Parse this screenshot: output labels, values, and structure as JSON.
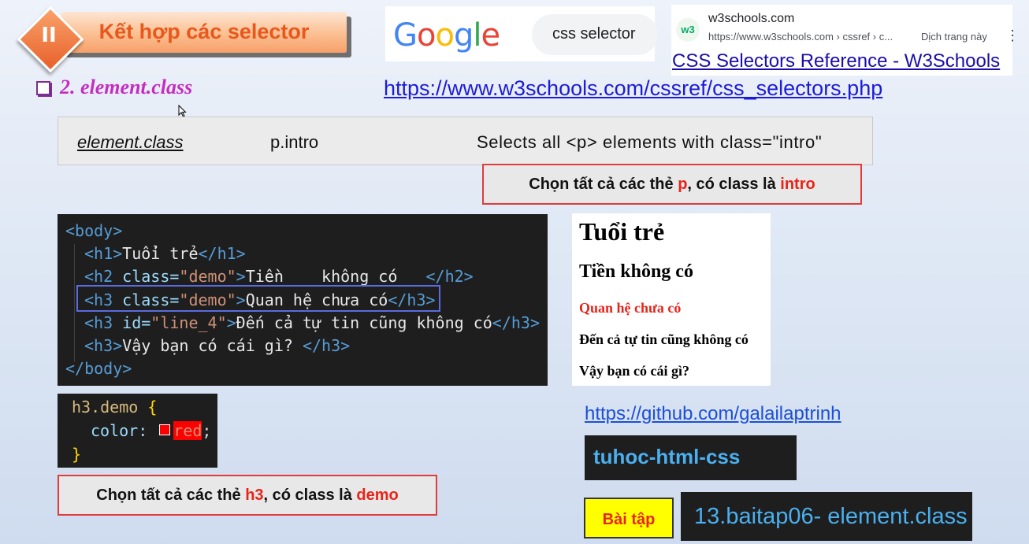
{
  "banner": {
    "number": "II",
    "title": "Kết hợp các selector"
  },
  "google": {
    "logo": "Google",
    "query": "css selector"
  },
  "w3_result": {
    "icon": "w3",
    "site": "w3schools.com",
    "url": "https://www.w3schools.com › cssref › c...",
    "translate": "Dịch trang này",
    "menu_icon": "⋮",
    "title": "CSS Selectors Reference - W3Schools"
  },
  "section": {
    "title": "2.  element.class",
    "reference_url": "https://www.w3schools.com/cssref/css_selectors.php"
  },
  "reference_row": {
    "selector": "element.class",
    "example": "p.intro",
    "description": "Selects all <p> elements with class=\"intro\""
  },
  "note_top": {
    "prefix": "Chọn tất cả các thẻ ",
    "tag": "p",
    "middle": ", có class là ",
    "cls": "intro"
  },
  "note_bottom": {
    "prefix": "Chọn tất cả các thẻ ",
    "tag": "h3",
    "middle": ", có class là ",
    "cls": "demo"
  },
  "html_code": [
    {
      "open": "<body>"
    },
    {
      "open": "<h1>",
      "text": "Tuổi trẻ",
      "close": "</h1>"
    },
    {
      "open": "<h2 ",
      "attr": "class=",
      "val": "\"demo\"",
      "gt": ">",
      "text": "Tiền    không có   ",
      "close": "</h2>"
    },
    {
      "open": "<h3 ",
      "attr": "class=",
      "val": "\"demo\"",
      "gt": ">",
      "text": "Quan hệ chưa có",
      "close": "</h3>"
    },
    {
      "open": "<h3 ",
      "attr": "id=",
      "val": "\"line_4\"",
      "gt": ">",
      "text": "Đến cả tự tin cũng không có",
      "close": "</h3>"
    },
    {
      "open": "<h3>",
      "text": "Vậy bạn có cái gì? ",
      "close": "</h3>"
    },
    {
      "open": "</body>"
    }
  ],
  "css_code": {
    "selector": "h3.demo",
    "open_brace": "{",
    "property": "color:",
    "value": "red",
    "semicolon": ";",
    "close_brace": "}",
    "swatch_color": "#ff0000"
  },
  "preview": {
    "h1": "Tuổi trẻ",
    "h2": "Tiền không có",
    "h3_demo": "Quan hệ chưa có",
    "h3_line4": "Đến cả tự tin cũng không có",
    "h3_last": "Vậy bạn có cái gì?"
  },
  "github_url": "https://github.com/galailaptrinh",
  "repo_name": "tuhoc-html-css",
  "exercise_button": "Bài tập",
  "exercise_name": "13.baitap06- element.class",
  "colors": {
    "accent_red": "#e8241a",
    "title_orange": "#e8581c",
    "heading_magenta": "#c42ec0",
    "link_blue": "#1c1cd8"
  }
}
